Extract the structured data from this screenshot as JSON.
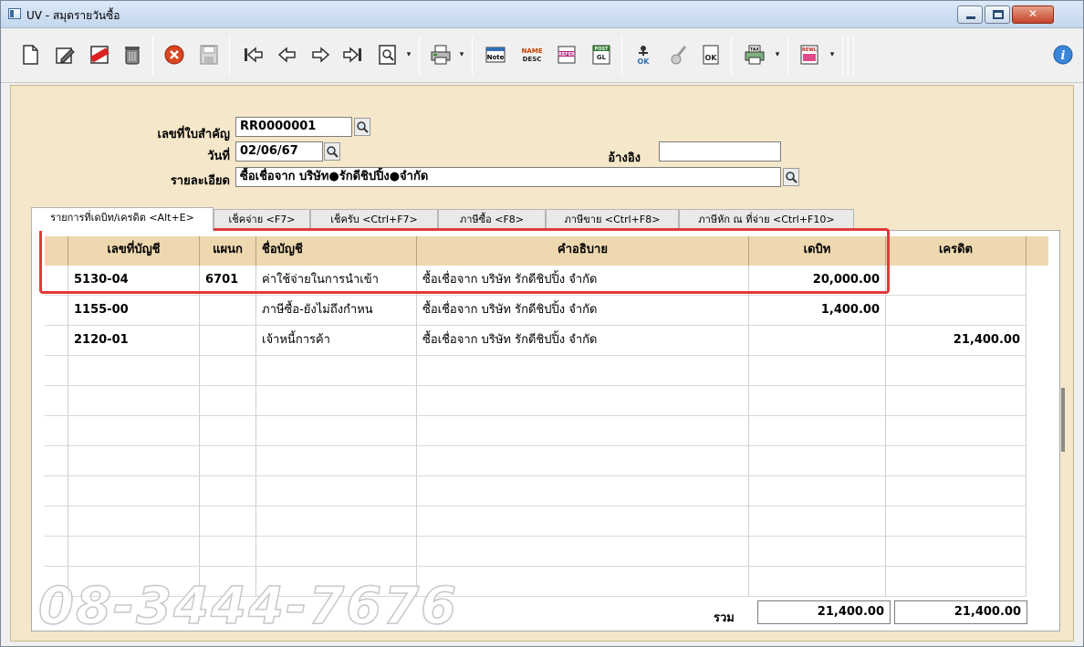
{
  "window": {
    "title": "UV - สมุดรายวันซื้อ",
    "min_glyph": "",
    "max_glyph": "",
    "close_glyph": "✕"
  },
  "toolbar": {
    "icons": [
      "new-icon",
      "edit-icon",
      "void-icon",
      "delete-icon",
      "cancel-icon",
      "save-icon",
      "first-icon",
      "prev-icon",
      "next-icon",
      "last-icon",
      "search-doc-icon",
      "print-icon",
      "note-icon",
      "name-desc-icon",
      "refer-icon",
      "post-gl-icon",
      "approve-icon",
      "unapprove-icon",
      "ok-doc-icon",
      "print-tax-icon",
      "report-icon",
      "info-icon"
    ],
    "labels": {
      "note": "Note",
      "name": "NAME",
      "desc": "DESC",
      "refer": "REFER",
      "post": "POST",
      "gl": "GL",
      "ok": "OK",
      "tax": "TAX",
      "rewl": "REWL"
    }
  },
  "form": {
    "doc_no_label": "เลขที่ใบสำคัญ",
    "doc_no_value": "RR0000001",
    "date_label": "วันที่",
    "date_value": "02/06/67",
    "ref_label": "อ้างอิง",
    "ref_value": "",
    "detail_label": "รายละเอียด",
    "detail_value": "ซื้อเชื่อจาก  บริษัท●รักดีชิปปิ้ง●จำกัด"
  },
  "tabs": [
    {
      "label": "รายการที่เดบิท/เครดิต <Alt+E>",
      "active": true
    },
    {
      "label": "เช็คจ่าย <F7>"
    },
    {
      "label": "เช็ครับ <Ctrl+F7>"
    },
    {
      "label": "ภาษีซื้อ <F8>"
    },
    {
      "label": "ภาษีขาย <Ctrl+F8>"
    },
    {
      "label": "ภาษีหัก ณ ที่จ่าย <Ctrl+F10>"
    }
  ],
  "grid": {
    "headers": {
      "account": "เลขที่บัญชี",
      "dept": "แผนก",
      "name": "ชื่อบัญชี",
      "desc": "คำอธิบาย",
      "debit": "เดบิท",
      "credit": "เครดิต"
    },
    "rows": [
      {
        "account": "5130-04",
        "dept": "6701",
        "name": "ค่าใช้จ่ายในการนำเข้า",
        "desc": "ซื้อเชื่อจาก  บริษัท รักดีชิปปิ้ง จำกัด",
        "debit": "20,000.00",
        "credit": ""
      },
      {
        "account": "1155-00",
        "dept": "",
        "name": "ภาษีซื้อ-ยังไม่ถึงกำหน",
        "desc": "ซื้อเชื่อจาก  บริษัท รักดีชิปปิ้ง จำกัด",
        "debit": "1,400.00",
        "credit": ""
      },
      {
        "account": "2120-01",
        "dept": "",
        "name": "เจ้าหนี้การค้า",
        "desc": "ซื้อเชื่อจาก  บริษัท รักดีชิปปิ้ง จำกัด",
        "debit": "",
        "credit": "21,400.00"
      }
    ]
  },
  "totals": {
    "label": "รวม",
    "debit": "21,400.00",
    "credit": "21,400.00"
  },
  "watermark": "08-3444-7676"
}
